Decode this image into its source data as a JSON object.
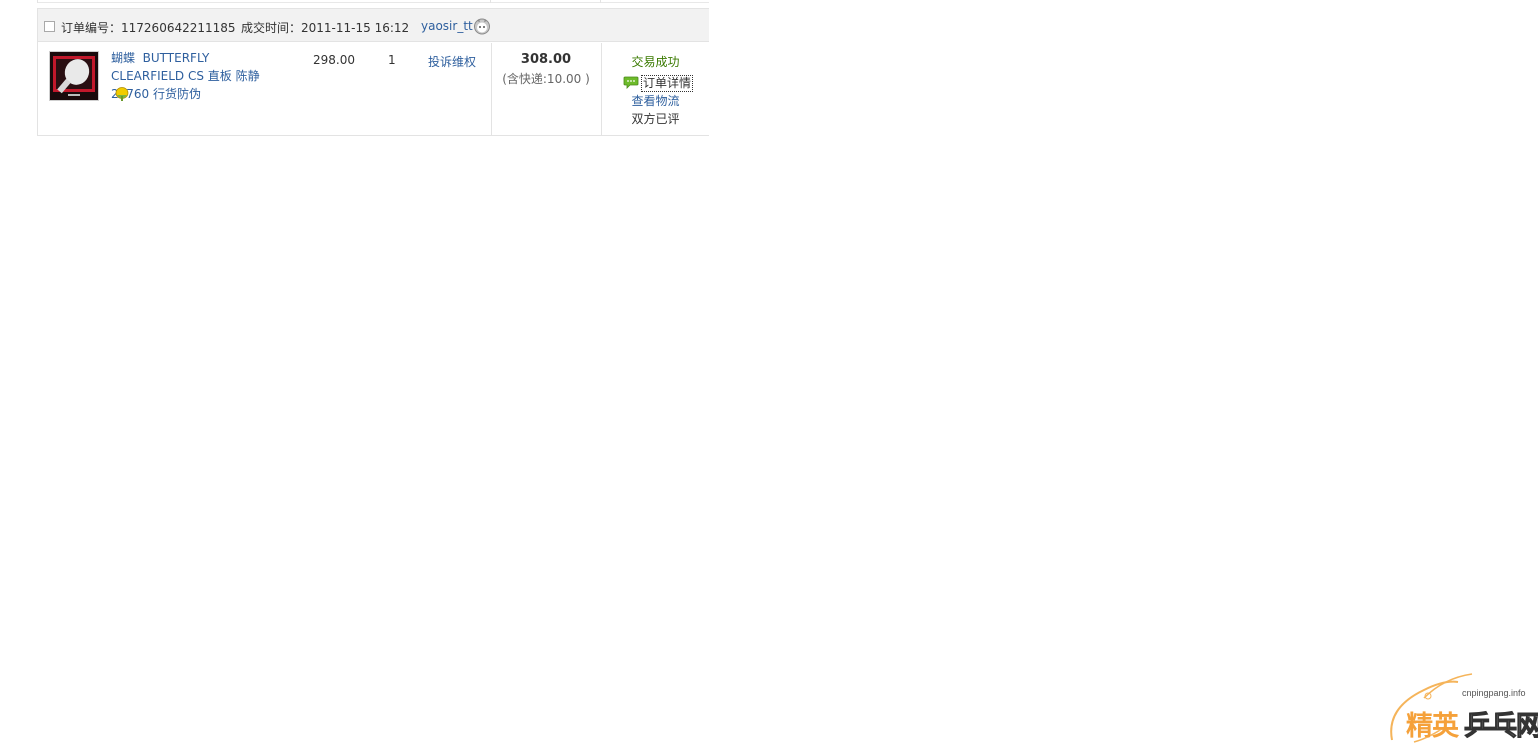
{
  "order": {
    "order_no_label": "订单编号：",
    "order_no": "117260642211185",
    "deal_time_label": "成交时间：",
    "deal_time": "2011-11-15 16:12",
    "seller": "yaosir_tt"
  },
  "item": {
    "title_brand": "蝴蝶",
    "title_rest": "BUTTERFLY CLEARFIELD CS 直板 陈静 20760 行货防伪",
    "unit_price": "298.00",
    "quantity": "1",
    "complain_label": "投诉维权",
    "total": "308.00",
    "shipping_note": "(含快递:10.00 )",
    "status": "交易成功",
    "detail_link": "订单详情",
    "logistics_link": "查看物流",
    "rated_text": "双方已评"
  },
  "watermark": {
    "url": "cnpingpang.info",
    "name_part1": "精英",
    "name_part2": "乒乓网"
  },
  "colors": {
    "link": "#2e5f9e",
    "status_green": "#3a7a00",
    "header_bg": "#f2f2f2",
    "border": "#e3e3e3",
    "watermark_orange": "#f5a13a"
  }
}
